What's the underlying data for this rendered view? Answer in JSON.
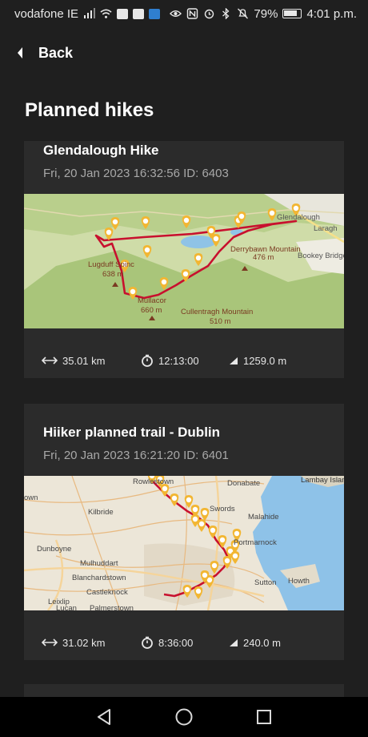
{
  "status_bar": {
    "carrier": "vodafone IE",
    "battery": "79%",
    "time": "4:01 p.m."
  },
  "header": {
    "back_label": "Back",
    "title": "Planned hikes"
  },
  "hikes": [
    {
      "title": "Glendalough Hike",
      "meta": "Fri, 20 Jan 2023 16:32:56 ID: 6403",
      "distance": "35.01 km",
      "duration": "12:13:00",
      "elevation": "1259.0 m",
      "map_labels": {
        "l1": "Glendalough",
        "l2": "Laragh",
        "l3": "Derrybawn Mountain",
        "l4": "476 m",
        "l5": "Bookey Bridge",
        "l6": "Lugduff Spinc",
        "l7": "638 m",
        "l8": "Mullacor",
        "l9": "660 m",
        "l10": "Cullentragh Mountain",
        "l11": "510 m"
      }
    },
    {
      "title": "Hiiker planned trail - Dublin",
      "meta": "Fri, 20 Jan 2023 16:21:20 ID: 6401",
      "distance": "31.02 km",
      "duration": "8:36:00",
      "elevation": "240.0 m",
      "map_labels": {
        "l1": "Rowlestown",
        "l2": "Donabate",
        "l3": "Lambay Island",
        "l4": "own",
        "l5": "Swords",
        "l6": "Kilbride",
        "l7": "Malahide",
        "l8": "Dunboyne",
        "l9": "Portmarnock",
        "l10": "Mulhuddart",
        "l11": "Blanchardstown",
        "l12": "Sutton",
        "l13": "Howth",
        "l14": "Castleknock",
        "l15": "Leixlip",
        "l16": "Lucan",
        "l17": "Palmerstown"
      }
    }
  ],
  "colors": {
    "route": "#c8102e",
    "marker": "#f2b632",
    "card": "#2b2b2b",
    "background": "#1f1f1f"
  },
  "icons": [
    "chevron-left-icon",
    "distance-icon",
    "stopwatch-icon",
    "elevation-icon",
    "nav-back-icon",
    "nav-home-icon",
    "nav-recents-icon"
  ]
}
